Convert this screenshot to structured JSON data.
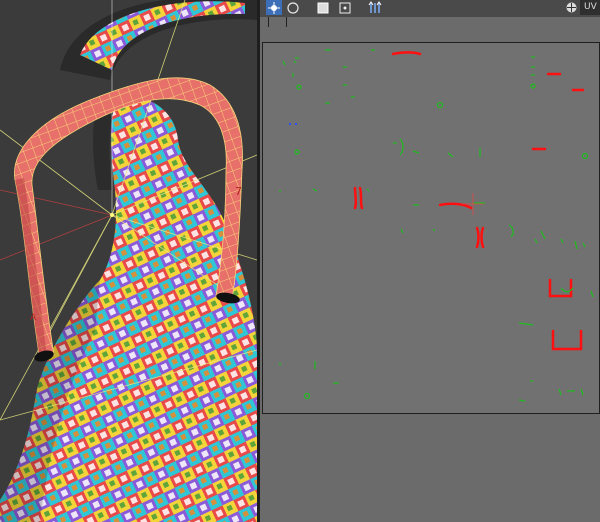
{
  "uv_editor": {
    "label": "UV",
    "toolbar_icons": [
      "select-uv-icon",
      "circle-select-icon",
      "square-icon",
      "dot-square-icon",
      "uv-move-icon"
    ],
    "checker_icon": "checker-ball-icon"
  },
  "viewport": {
    "object": "checker-textured-vase-with-handle"
  },
  "colors": {
    "uv_background": "#717171",
    "selected_uv_edges": "#ff0000",
    "unselected_uv_edges": "#00c000",
    "handle_highlight": "#e8695f",
    "gizmo_lines": "#ffff80"
  }
}
